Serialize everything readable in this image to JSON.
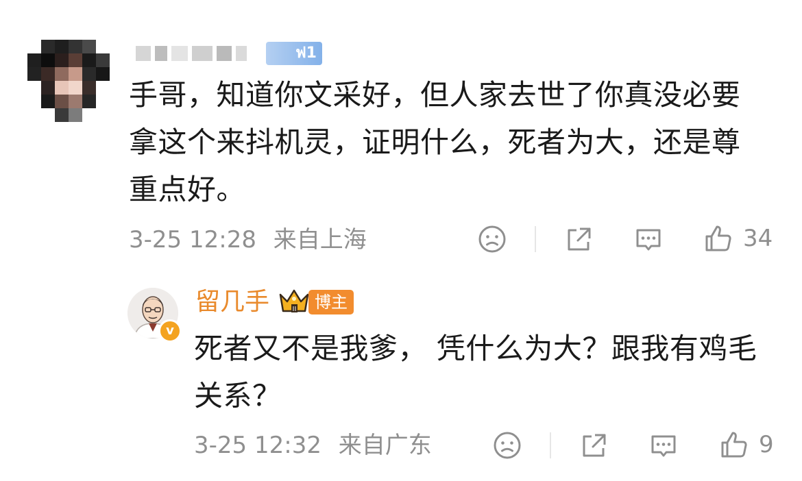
{
  "comment": {
    "text_line1": "手哥，知道你文采好，但人家去世了你真没必要",
    "text_line2": "拿这个来抖机灵，证明什么，死者为大，还是尊",
    "text_line3": "重点好。",
    "date": "3-25 12:28",
    "location": "来自上海",
    "likes": "34",
    "icons": [
      "emoji-icon",
      "share-icon",
      "comment-icon",
      "like-icon"
    ]
  },
  "reply": {
    "username": "留几手",
    "host_badge": "博主",
    "verified_mark": "v",
    "text_line1": "死者又不是我爹， 凭什么为大？跟我有鸡毛",
    "text_line2": "关系？",
    "date": "3-25 12:32",
    "location": "来自广东",
    "likes": "9",
    "icons": [
      "emoji-icon",
      "share-icon",
      "comment-icon",
      "like-icon"
    ]
  },
  "colors": {
    "text": "#1a1a1a",
    "meta": "#8f8f8f",
    "username": "#e98a2c",
    "badge": "#f28c2e",
    "verified": "#f4a320"
  }
}
